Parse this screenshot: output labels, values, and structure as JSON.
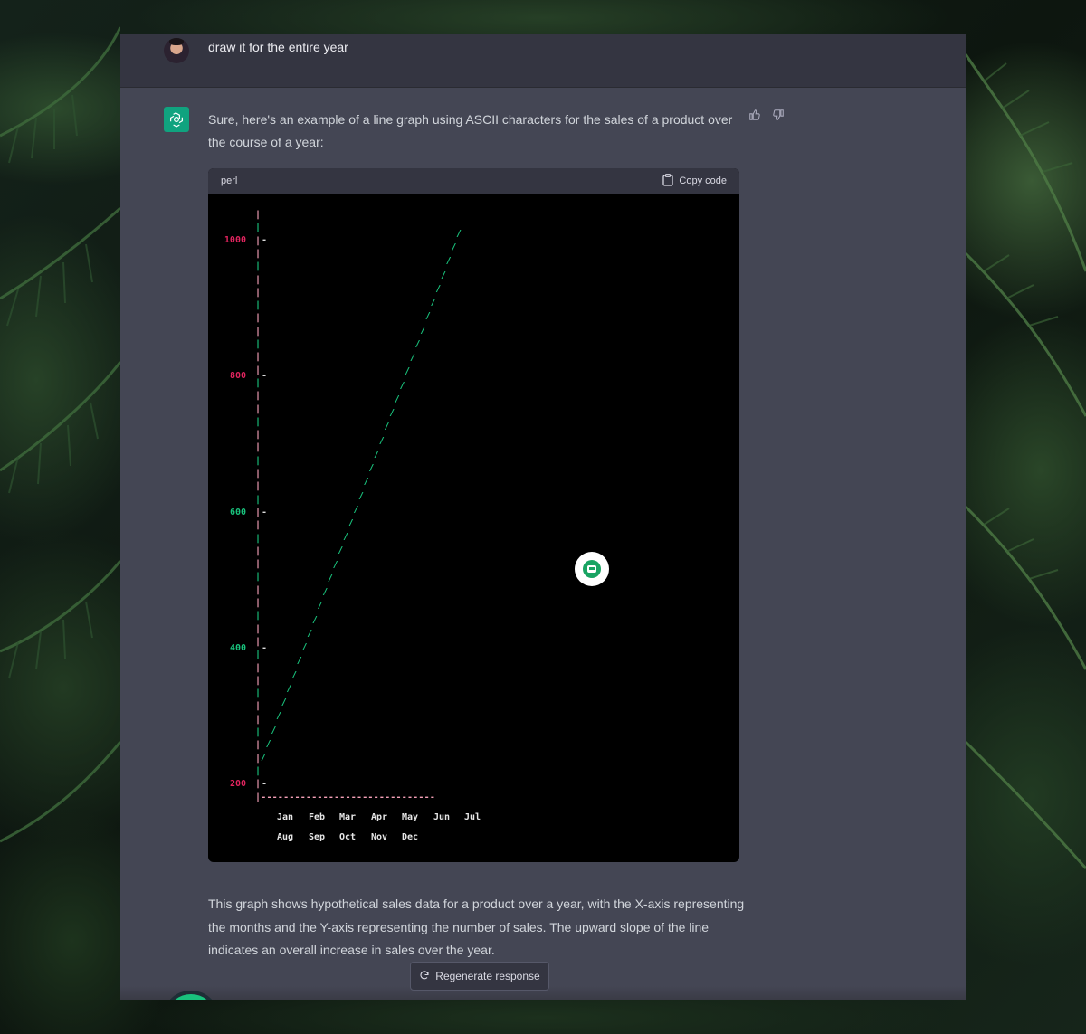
{
  "conversation": {
    "user_message": "draw it for the entire year",
    "assistant_intro": "Sure, here's an example of a line graph using ASCII characters for the sales of a product over the course of a year:",
    "assistant_outro": "This graph shows hypothetical sales data for a product over a year, with the X-axis representing the months and the Y-axis representing the number of sales. The upward slope of the line indicates an overall increase in sales over the year."
  },
  "code_block": {
    "language": "perl",
    "copy_label": "Copy code"
  },
  "actions": {
    "regenerate_label": "Regenerate response",
    "thumbs_up_icon": "thumbs-up-icon",
    "thumbs_down_icon": "thumbs-down-icon"
  },
  "colors": {
    "accent": "#10a37f",
    "ascii_red": "#e0245e",
    "ascii_green": "#19c37d",
    "ascii_pink": "#f5a0b8",
    "panel": "#444654",
    "panel_dark": "#343541"
  },
  "chart_data": {
    "type": "line",
    "title": "",
    "xlabel": "",
    "ylabel": "",
    "y_ticks": [
      "1000",
      "800",
      "600",
      "400",
      "200"
    ],
    "ylim": [
      200,
      1000
    ],
    "categories_row1": [
      "Jan",
      "Feb",
      "Mar",
      "Apr",
      "May",
      "Jun",
      "Jul"
    ],
    "categories_row2": [
      "Aug",
      "Sep",
      "Oct",
      "Nov",
      "Dec"
    ],
    "axis_line": "|-------------------------------",
    "series": [
      {
        "x": [
          0,
          1
        ],
        "values": [
          200,
          1000
        ]
      }
    ]
  }
}
